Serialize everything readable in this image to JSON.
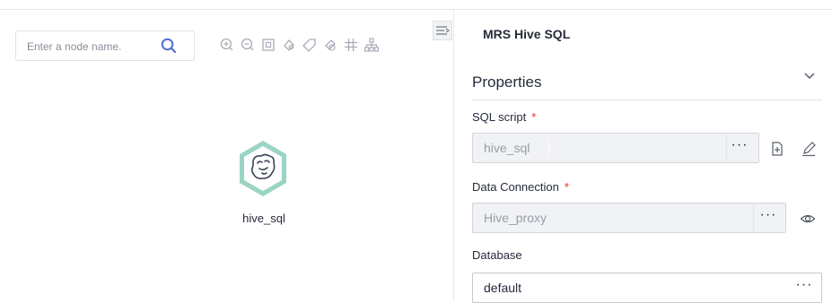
{
  "search": {
    "placeholder": "Enter a node name."
  },
  "toolbar": {
    "icons": [
      "zoom-in-icon",
      "zoom-out-icon",
      "fit-view-icon",
      "auto-layout-icon",
      "tag-icon",
      "format-icon",
      "grid-icon",
      "hierarchy-icon"
    ]
  },
  "canvas": {
    "node": {
      "label": "hive_sql",
      "icon": "hive-bee-icon",
      "color": "#9ad4c5"
    }
  },
  "panel": {
    "title": "MRS Hive SQL",
    "section_title": "Properties",
    "fields": {
      "sql_script": {
        "label": "SQL script",
        "required_mark": "*",
        "value": "hive_sql",
        "more": "···"
      },
      "data_connection": {
        "label": "Data Connection",
        "required_mark": "*",
        "value": "Hive_proxy",
        "more": "···"
      },
      "database": {
        "label": "Database",
        "value": "default",
        "more": "···"
      }
    }
  },
  "colors": {
    "accent": "#526ecc",
    "required": "#f5222d",
    "node_ring": "#9ad4c5"
  }
}
